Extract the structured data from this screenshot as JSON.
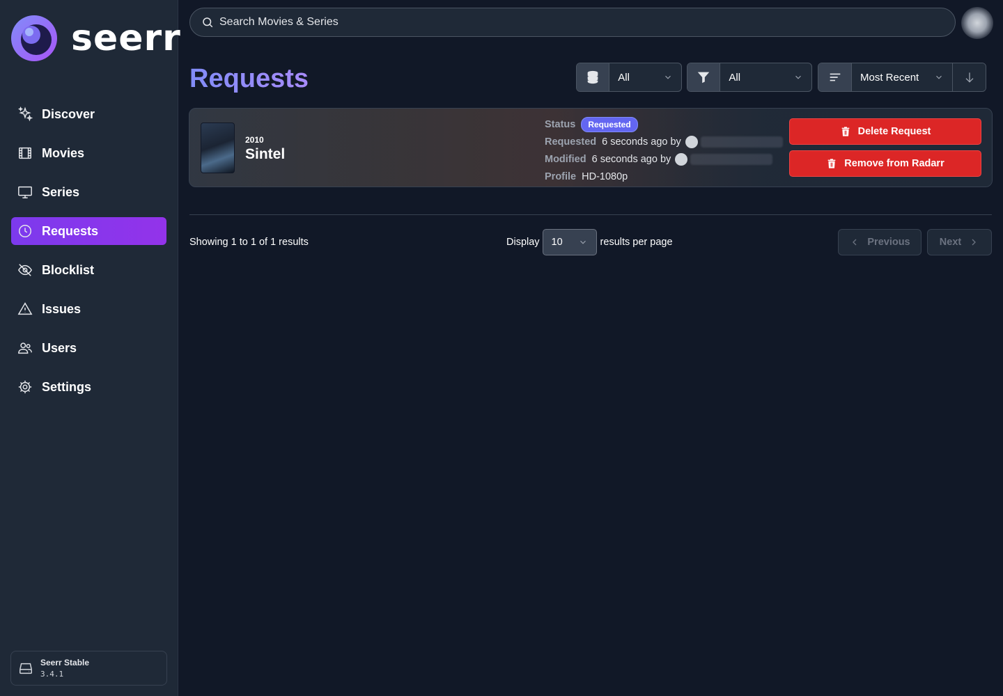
{
  "app": {
    "name": "seerr"
  },
  "sidebar": {
    "items": [
      {
        "label": "Discover",
        "icon": "sparkles-icon"
      },
      {
        "label": "Movies",
        "icon": "film-icon"
      },
      {
        "label": "Series",
        "icon": "tv-icon"
      },
      {
        "label": "Requests",
        "icon": "clock-icon",
        "active": true
      },
      {
        "label": "Blocklist",
        "icon": "eye-off-icon"
      },
      {
        "label": "Issues",
        "icon": "warning-icon"
      },
      {
        "label": "Users",
        "icon": "users-icon"
      },
      {
        "label": "Settings",
        "icon": "gear-icon"
      }
    ],
    "version": {
      "name": "Seerr Stable",
      "number": "3.4.1"
    }
  },
  "search": {
    "placeholder": "Search Movies & Series"
  },
  "page": {
    "title": "Requests"
  },
  "filters": {
    "media_type": "All",
    "status": "All",
    "sort": "Most Recent"
  },
  "request": {
    "year": "2010",
    "title": "Sintel",
    "status_label": "Status",
    "status": "Requested",
    "requested_label": "Requested",
    "requested_value": "6 seconds ago by",
    "modified_label": "Modified",
    "modified_value": "6 seconds ago by",
    "profile_label": "Profile",
    "profile_value": "HD-1080p",
    "delete_label": "Delete Request",
    "remove_label": "Remove from Radarr"
  },
  "pagination": {
    "showing": "Showing 1 to 1 of 1 results",
    "display_label": "Display",
    "per_page_value": "10",
    "per_page_suffix": "results per page",
    "previous_label": "Previous",
    "next_label": "Next"
  },
  "colors": {
    "accent": "#7c3aed",
    "danger": "#dc2626",
    "badge": "#6366f1",
    "background": "#111827",
    "sidebar": "#1f2937"
  }
}
